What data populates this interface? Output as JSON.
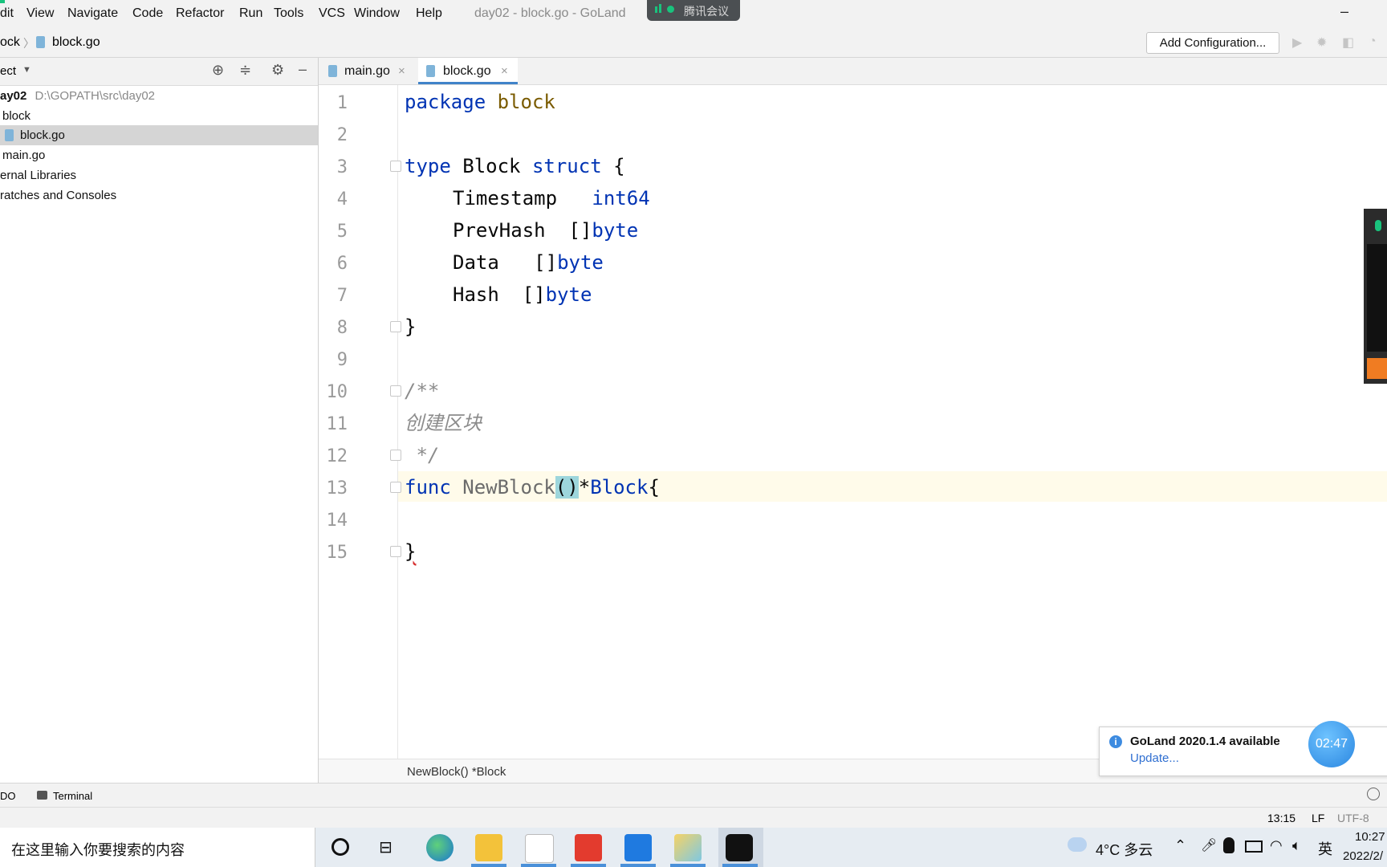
{
  "menu": {
    "items": [
      "dit",
      "View",
      "Navigate",
      "Code",
      "Refactor",
      "Run",
      "Tools",
      "VCS",
      "Window",
      "Help"
    ],
    "window_title": "day02 - block.go - GoLand",
    "meeting_label": "腾讯会议",
    "minimize": "–"
  },
  "navbar": {
    "crumb_parent": "ock",
    "crumb_file": "block.go",
    "add_config": "Add Configuration..."
  },
  "project": {
    "header": "ect",
    "tree": [
      {
        "label": "ay02",
        "path": "D:\\GOPATH\\src\\day02"
      },
      {
        "label": "block"
      },
      {
        "label": "block.go"
      },
      {
        "label": "main.go"
      },
      {
        "label": "ernal Libraries"
      },
      {
        "label": "ratches and Consoles"
      }
    ]
  },
  "tabs": [
    {
      "label": "main.go",
      "close": "×"
    },
    {
      "label": "block.go",
      "close": "×"
    }
  ],
  "editor": {
    "line_numbers": [
      "1",
      "2",
      "3",
      "4",
      "5",
      "6",
      "7",
      "8",
      "9",
      "10",
      "11",
      "12",
      "13",
      "14",
      "15"
    ],
    "code": {
      "l1_kw": "package",
      "l1_name": "block",
      "l3_kw": "type",
      "l3_name": "Block",
      "l3_struct": "struct",
      "l3_brace": "{",
      "l4_field": "Timestamp",
      "l4_type": "int64",
      "l5_field": "PrevHash",
      "l5_brackets": "[]",
      "l5_type": "byte",
      "l6_field": "Data",
      "l6_brackets": "[]",
      "l6_type": "byte",
      "l7_field": "Hash",
      "l7_brackets": "[]",
      "l7_type": "byte",
      "l8": "}",
      "l10": "/**",
      "l11": "创建区块",
      "l12": " */",
      "l13_kw": "func",
      "l13_name": "NewBlock",
      "l13_paren": "()",
      "l13_star": "*",
      "l13_type": "Block",
      "l13_brace": "{",
      "l15": "}"
    },
    "breadcrumb": "NewBlock() *Block"
  },
  "bottom_tools": {
    "todo": "DO",
    "terminal": "Terminal"
  },
  "status": {
    "position": "13:15",
    "line_sep": "LF",
    "encoding": "UTF-8"
  },
  "notification": {
    "title": "GoLand 2020.1.4 available",
    "link": "Update..."
  },
  "timer": "02:47",
  "taskbar": {
    "search_placeholder": "在这里输入你要搜索的内容",
    "weather": "4°C 多云",
    "ime": "英",
    "time": "10:27",
    "date": "2022/2/"
  },
  "colors": {
    "accent": "#19c37d",
    "keyword": "#0033b3",
    "package_name": "#7a5b00",
    "comment": "#8c8c8c"
  }
}
